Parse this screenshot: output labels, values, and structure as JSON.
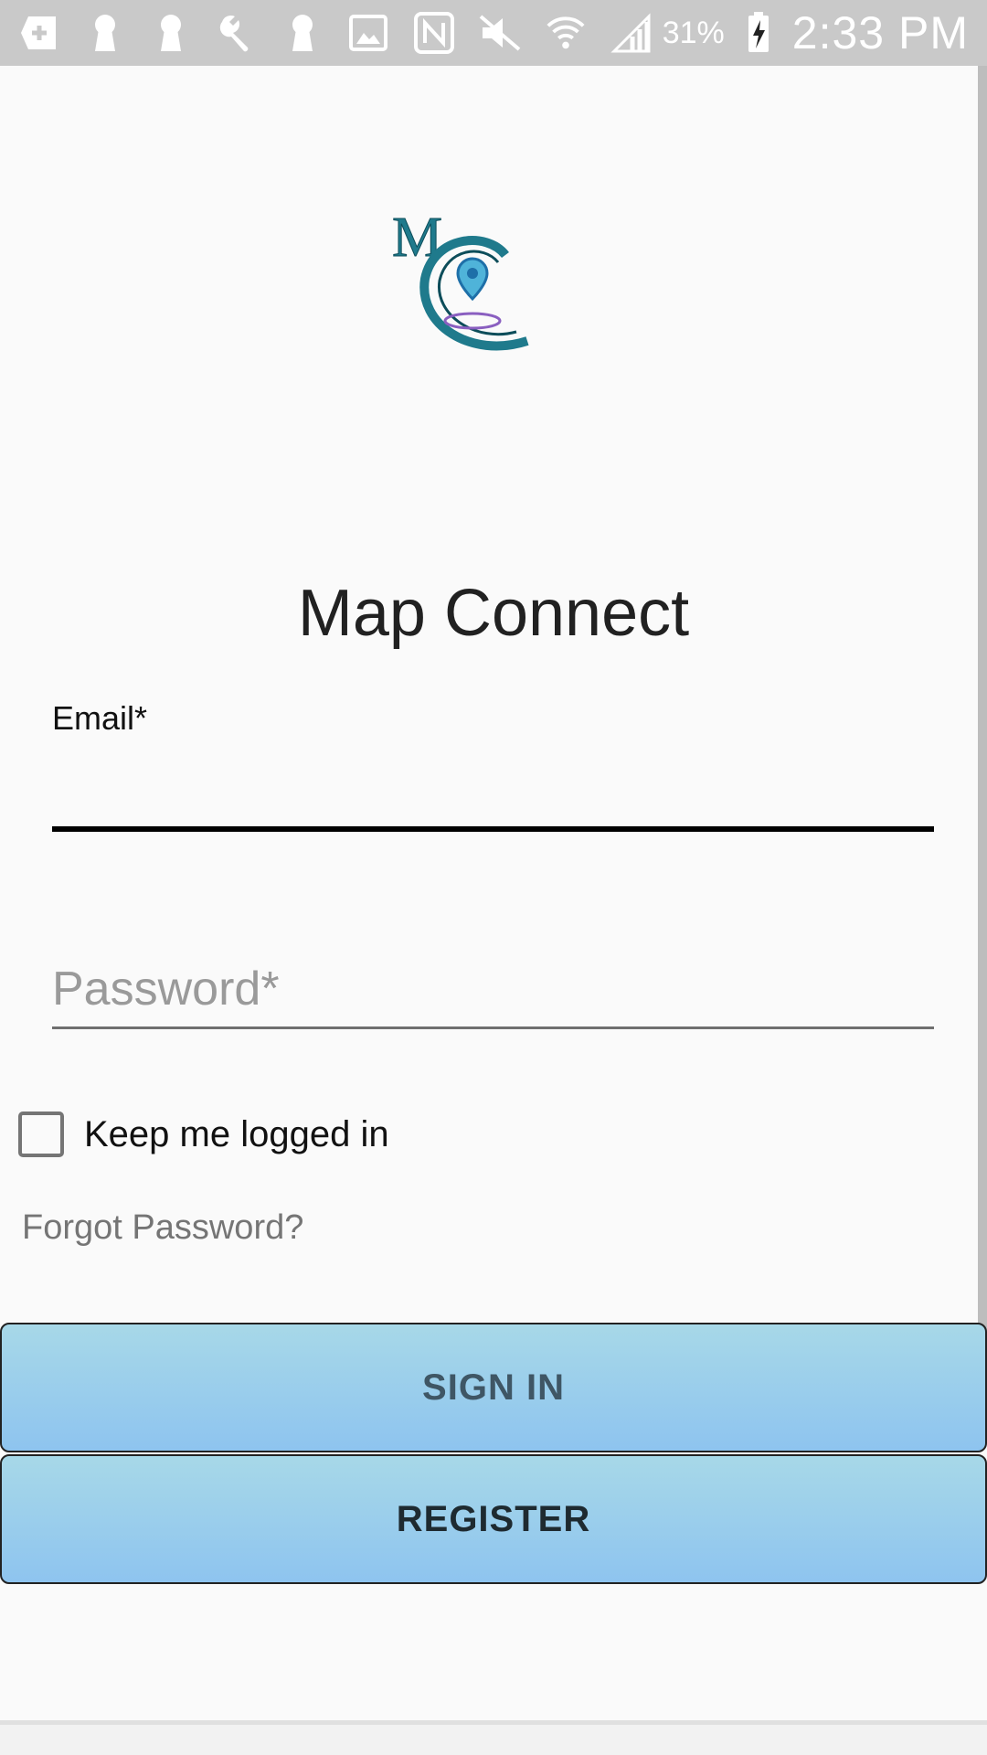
{
  "status_bar": {
    "battery_percent": "31%",
    "time": "2:33 PM",
    "icons": [
      "add-box-icon",
      "keyhole-icon",
      "keyhole-icon",
      "wrench-icon",
      "keyhole-icon",
      "image-icon",
      "nfc-icon",
      "mute-icon",
      "wifi-icon",
      "signal-icon",
      "battery-charging-icon"
    ]
  },
  "login": {
    "title": "Map Connect",
    "email_label": "Email*",
    "email_value": "",
    "password_placeholder": "Password*",
    "keep_logged_in_label": "Keep me logged in",
    "keep_logged_in_checked": false,
    "forgot_password": "Forgot Password?",
    "sign_in_label": "SIGN IN",
    "register_label": "REGISTER"
  },
  "colors": {
    "background": "#fafafa",
    "button_top": "#a7d8e8",
    "button_bottom": "#8ec4ef",
    "logo_teal": "#1f7a8c"
  }
}
